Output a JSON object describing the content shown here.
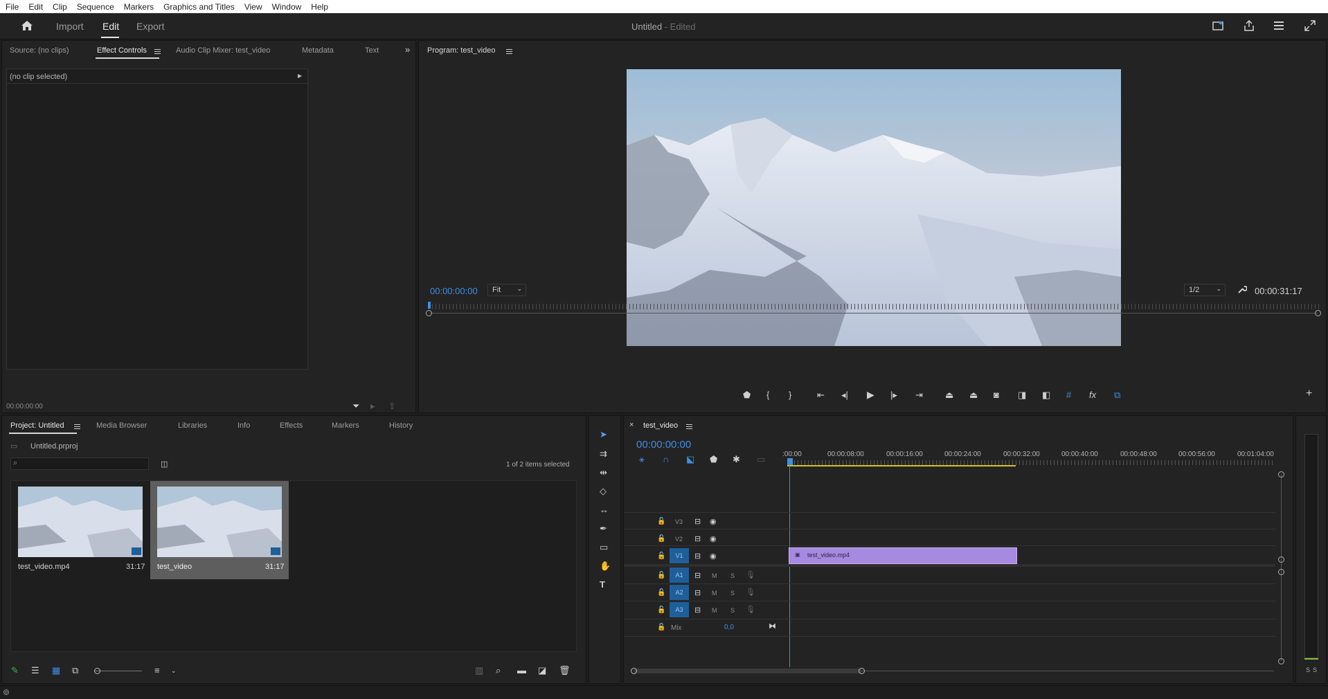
{
  "menu": [
    "File",
    "Edit",
    "Clip",
    "Sequence",
    "Markers",
    "Graphics and Titles",
    "View",
    "Window",
    "Help"
  ],
  "topbar": {
    "tabs": [
      "Import",
      "Edit",
      "Export"
    ],
    "active": "Edit",
    "title": "Untitled",
    "title_suffix": "- Edited"
  },
  "source_panel": {
    "tabs": [
      "Source: (no clips)",
      "Effect Controls",
      "Audio Clip Mixer: test_video",
      "Metadata",
      "Text"
    ],
    "no_clip": "(no clip selected)",
    "timecode": "00:00:00:00"
  },
  "program": {
    "title": "Program: test_video",
    "timecode": "00:00:00:00",
    "fit": "Fit",
    "resolution": "1/2",
    "duration": "00:00:31:17"
  },
  "project": {
    "tabs": [
      "Project: Untitled",
      "Media Browser",
      "Libraries",
      "Info",
      "Effects",
      "Markers",
      "History"
    ],
    "file": "Untitled.prproj",
    "search_placeholder": "",
    "selection": "1 of 2 items selected",
    "items": [
      {
        "name": "test_video.mp4",
        "duration": "31:17"
      },
      {
        "name": "test_video",
        "duration": "31:17"
      }
    ]
  },
  "timeline": {
    "title": "test_video",
    "timecode": "00:00:00:00",
    "ruler": [
      ":00:00",
      "00:00:08:00",
      "00:00:16:00",
      "00:00:24:00",
      "00:00:32:00",
      "00:00:40:00",
      "00:00:48:00",
      "00:00:56:00",
      "00:01:04:00"
    ],
    "video_tracks": [
      "V3",
      "V2",
      "V1"
    ],
    "audio_tracks": [
      "A1",
      "A2",
      "A3"
    ],
    "mix_label": "Mix",
    "mix_value": "0,0",
    "clip": "test_video.mp4",
    "m_label": "M",
    "s_label": "S"
  },
  "meter": {
    "labels": [
      "S",
      "S"
    ]
  },
  "colors": {
    "accent": "#3d8ee6",
    "clip": "#a689e0",
    "target": "#1f5f99"
  }
}
